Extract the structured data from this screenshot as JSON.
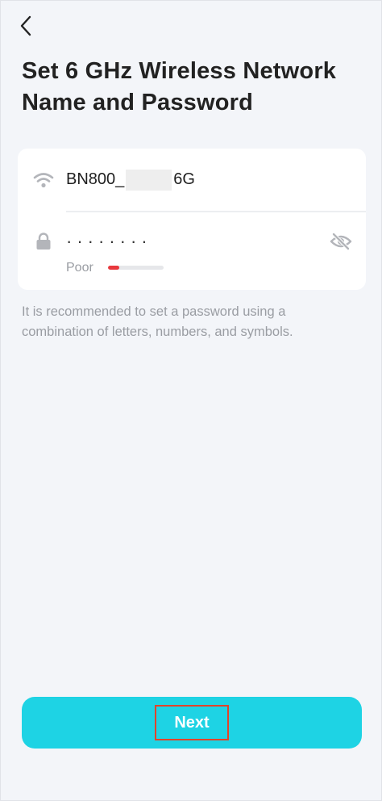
{
  "header": {
    "back_icon": "chevron-left-icon",
    "title": "Set 6 GHz Wireless Network Name and Password"
  },
  "form": {
    "ssid": {
      "icon": "wifi-icon",
      "prefix": "BN800_",
      "suffix": "6G"
    },
    "password": {
      "icon": "lock-icon",
      "masked_value": "········",
      "visibility_icon": "eye-off-icon",
      "strength_label": "Poor",
      "strength_fraction": 0.2,
      "strength_color": "#e8383d"
    }
  },
  "hint": "It is recommended to set a password using a combination of letters, numbers, and symbols.",
  "footer": {
    "next_label": "Next",
    "button_color": "#1ed3e4"
  }
}
